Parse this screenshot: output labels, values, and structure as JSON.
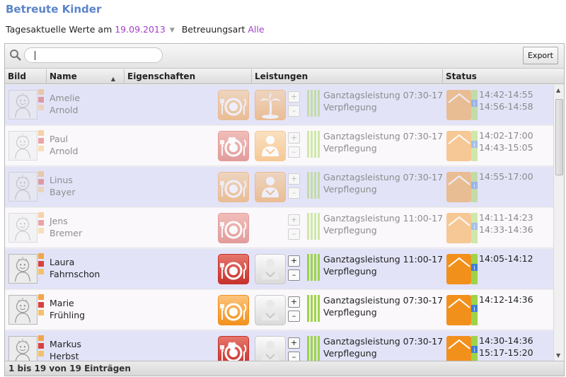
{
  "page": {
    "title": "Betreute Kinder",
    "values_label": "Tagesaktuelle Werte am",
    "date": "19.09.2013",
    "care_type_label": "Betreuungsart",
    "care_type_value": "Alle"
  },
  "toolbar": {
    "search_value": "",
    "export_label": "Export"
  },
  "columns": {
    "photo": "Bild",
    "name": "Name",
    "properties": "Eigenschaften",
    "services": "Leistungen",
    "status": "Status"
  },
  "colors": {
    "title": "#5b84c9",
    "link": "#a040c8",
    "row_odd": "#e3e3f8",
    "row_even": "#faf8fb",
    "bar_green": "#9ed34a",
    "orange": "#f39a29",
    "red": "#cf3b36"
  },
  "rows": [
    {
      "first": "Amelie",
      "last": "Arnold",
      "service": "Ganztagsleistung 07:30-17",
      "meal": "Verpflegung",
      "time1": "14:42-14:55",
      "time2": "14:56-14:58",
      "meal_icon": "plate-icon",
      "care_icon": "palm-tree-icon",
      "meal_color": "orange",
      "care_color": "orange",
      "status_color": "orange",
      "dim": true
    },
    {
      "first": "Paul",
      "last": "Arnold",
      "service": "Ganztagsleistung 07:30-17",
      "meal": "Verpflegung",
      "time1": "14:02-17:00",
      "time2": "14:43-15:05",
      "meal_icon": "plate-apple-icon",
      "care_icon": "person-icon",
      "meal_color": "red",
      "care_color": "orange",
      "status_color": "orange",
      "dim": true
    },
    {
      "first": "Linus",
      "last": "Bayer",
      "service": "Ganztagsleistung 07:30-17",
      "meal": "Verpflegung",
      "time1": "14:55-17:00",
      "time2": "",
      "meal_icon": "plate-icon",
      "care_icon": "person-icon",
      "meal_color": "orange",
      "care_color": "orange",
      "status_color": "orange",
      "dim": true
    },
    {
      "first": "Jens",
      "last": "Bremer",
      "service": "Ganztagsleistung 11:00-17",
      "meal": "Verpflegung",
      "time1": "14:11-14:23",
      "time2": "14:33-14:36",
      "meal_icon": "plate-icon",
      "care_icon": "",
      "meal_color": "red",
      "care_color": "",
      "status_color": "orange",
      "dim": true
    },
    {
      "first": "Laura",
      "last": "Fahrnschon",
      "service": "Ganztagsleistung 11:00-17",
      "meal": "Verpflegung",
      "time1": "14:05-14:12",
      "time2": "",
      "meal_icon": "plate-icon",
      "care_icon": "person-icon",
      "meal_color": "red",
      "care_color": "grey",
      "status_color": "orange",
      "dim": false
    },
    {
      "first": "Marie",
      "last": "Frühling",
      "service": "Ganztagsleistung 07:30-17",
      "meal": "Verpflegung",
      "time1": "14:12-14:36",
      "time2": "",
      "meal_icon": "plate-icon",
      "care_icon": "person-icon",
      "meal_color": "orange",
      "care_color": "grey",
      "status_color": "orange",
      "dim": false
    },
    {
      "first": "Markus",
      "last": "Herbst",
      "service": "Ganztagsleistung 07:30-17",
      "meal": "Verpflegung",
      "time1": "14:30-14:36",
      "time2": "15:17-15:20",
      "meal_icon": "plate-apple-icon",
      "care_icon": "person-icon",
      "meal_color": "red",
      "care_color": "grey",
      "status_color": "orange",
      "dim": false
    }
  ],
  "footer": {
    "summary": "1 bis 19 von 19 Einträgen"
  }
}
